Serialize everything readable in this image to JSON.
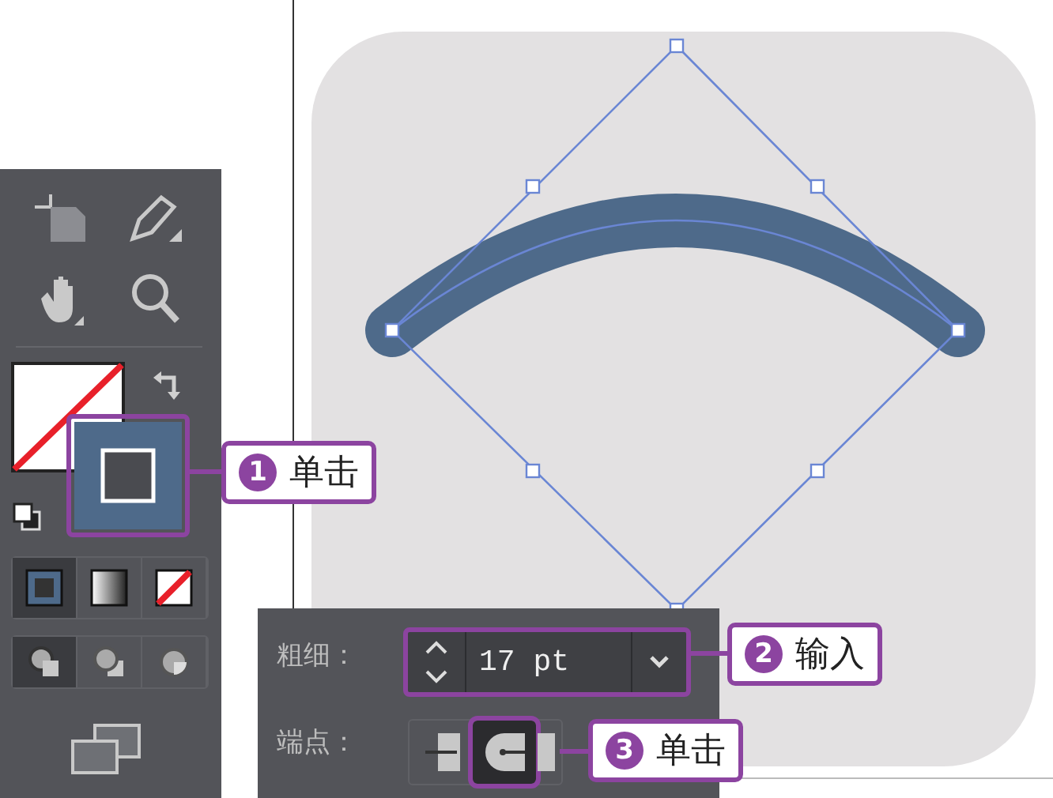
{
  "toolbar": {
    "color_modes": [
      {
        "kind": "color",
        "selected": true
      },
      {
        "kind": "gradient",
        "selected": false
      },
      {
        "kind": "none",
        "selected": false
      }
    ],
    "draw_modes": [
      {
        "kind": "normal",
        "selected": true
      },
      {
        "kind": "behind",
        "selected": false
      },
      {
        "kind": "inside",
        "selected": false
      }
    ]
  },
  "stroke_panel": {
    "weight_label": "粗细：",
    "weight_value": "17 pt",
    "cap_label": "端点：",
    "caps": [
      {
        "kind": "butt",
        "selected": false
      },
      {
        "kind": "round",
        "selected": true
      },
      {
        "kind": "square",
        "selected": false
      }
    ]
  },
  "callouts": [
    {
      "number": "1",
      "text": "单击"
    },
    {
      "number": "2",
      "text": "输入"
    },
    {
      "number": "3",
      "text": "单击"
    }
  ]
}
